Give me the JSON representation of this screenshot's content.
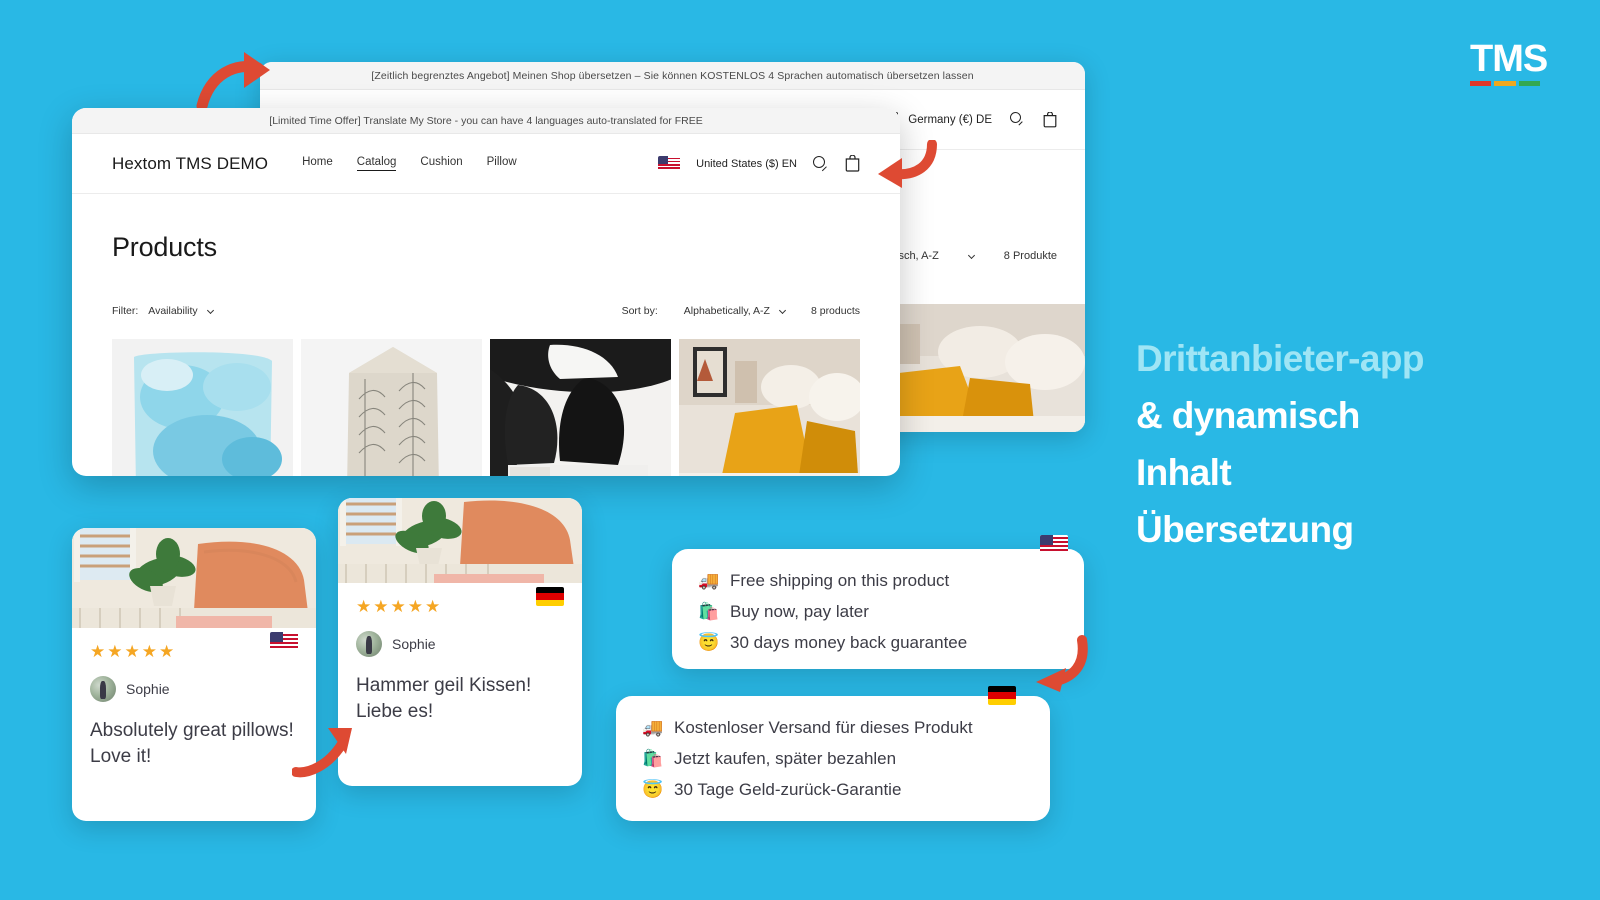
{
  "brand": {
    "logo_text": "TMS",
    "logo_bar_colors": [
      "#e0392b",
      "#f0a81e",
      "#33a852"
    ]
  },
  "background_color": "#29b8e5",
  "headline": {
    "lines": [
      {
        "text": "Drittanbieter-app",
        "color": "#9fe5f5"
      },
      {
        "text": "& dynamisch",
        "color": "#ffffff"
      },
      {
        "text": "Inhalt",
        "color": "#ffffff"
      },
      {
        "text": "Übersetzung",
        "color": "#ffffff"
      }
    ]
  },
  "store_de": {
    "banner": "[Zeitlich begrenztes Angebot] Meinen Shop übersetzen – Sie können KOSTENLOS 4 Sprachen automatisch übersetzen lassen",
    "locale_selector": "Germany (€) DE",
    "flag": "de-flag-icon",
    "search_icon": "search-icon",
    "cart_icon": "cart-icon",
    "sort_value": "habetisch, A-Z",
    "product_count": "8 Produkte"
  },
  "store_en": {
    "banner": "[Limited Time Offer] Translate My Store - you can have 4 languages auto-translated for FREE",
    "brand_name": "Hextom TMS DEMO",
    "nav": [
      {
        "label": "Home",
        "active": false
      },
      {
        "label": "Catalog",
        "active": true
      },
      {
        "label": "Cushion",
        "active": false
      },
      {
        "label": "Pillow",
        "active": false
      }
    ],
    "locale_selector": "United States ($) EN",
    "flag": "us-flag-icon",
    "search_icon": "search-icon",
    "cart_icon": "cart-icon",
    "page_title": "Products",
    "filter_label": "Filter:",
    "filter_value": "Availability",
    "sort_label": "Sort by:",
    "sort_value": "Alphabetically, A-Z",
    "product_count": "8 products",
    "products": [
      {
        "name": "watercolor-blue-pillow"
      },
      {
        "name": "fern-pattern-pillow"
      },
      {
        "name": "black-pillows"
      },
      {
        "name": "mustard-pillow-bed"
      }
    ]
  },
  "review_en": {
    "stars": "★★★★★",
    "rating": 5,
    "reviewer": "Sophie",
    "text": "Absolutely great pillows! Love it!",
    "flag": "us-flag-icon",
    "photo": "orange-pillow-bench"
  },
  "review_de": {
    "stars": "★★★★★",
    "rating": 5,
    "reviewer": "Sophie",
    "text": "Hammer geil Kissen! Liebe es!",
    "flag": "de-flag-icon",
    "photo": "orange-pillow-bench"
  },
  "benefits_en": {
    "flag": "us-flag-icon",
    "items": [
      {
        "emoji": "🚚",
        "text": "Free shipping on this product"
      },
      {
        "emoji": "🛍️",
        "text": "Buy now, pay later"
      },
      {
        "emoji": "😇",
        "text": "30 days money back guarantee"
      }
    ]
  },
  "benefits_de": {
    "flag": "de-flag-icon",
    "items": [
      {
        "emoji": "🚚",
        "text": "Kostenloser Versand für dieses Produkt"
      },
      {
        "emoji": "🛍️",
        "text": "Jetzt kaufen, später bezahlen"
      },
      {
        "emoji": "😇",
        "text": "30 Tage Geld-zurück-Garantie"
      }
    ]
  },
  "arrows": {
    "color": "#de4a33",
    "items": [
      {
        "name": "arrow-to-de-window",
        "direction": "right"
      },
      {
        "name": "arrow-to-de-locale",
        "direction": "left"
      },
      {
        "name": "arrow-to-de-review",
        "direction": "up-right"
      },
      {
        "name": "arrow-to-de-benefits",
        "direction": "down-left"
      }
    ]
  }
}
